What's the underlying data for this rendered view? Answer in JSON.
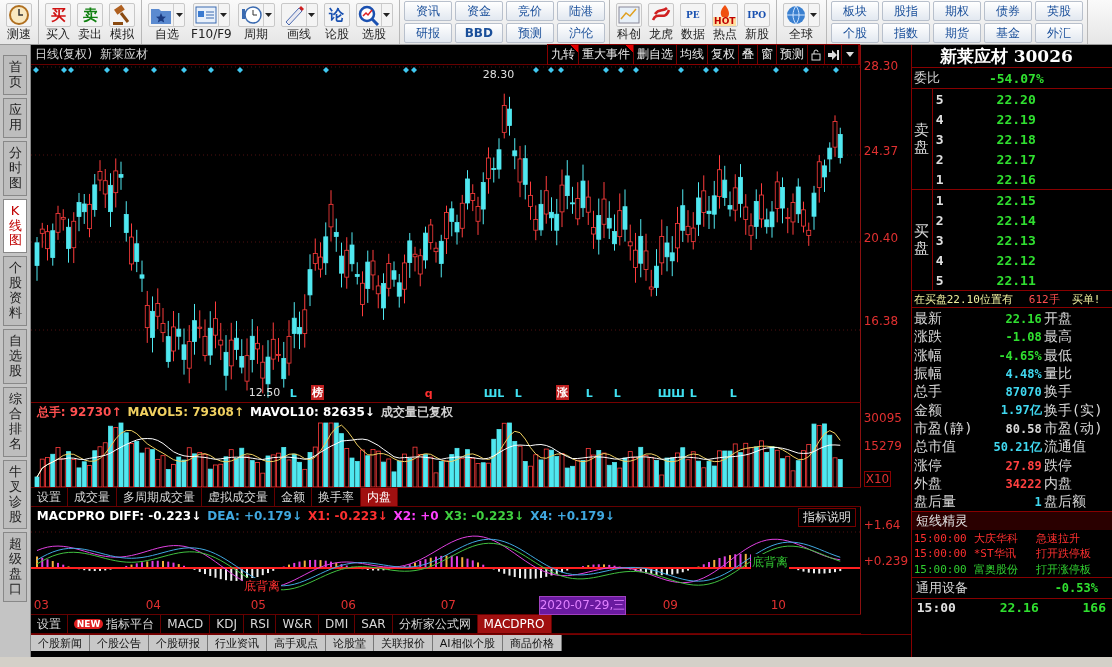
{
  "toolbar": {
    "groups": [
      {
        "kind": "tools",
        "items": [
          {
            "label": "测速",
            "dropdown": false
          }
        ]
      },
      {
        "kind": "tools",
        "items": [
          {
            "label": "买入",
            "glyph": "买",
            "dropdown": false
          },
          {
            "label": "卖出",
            "glyph": "卖",
            "dropdown": false
          },
          {
            "label": "模拟",
            "dropdown": false
          }
        ]
      },
      {
        "kind": "tools",
        "items": [
          {
            "label": "自选",
            "dropdown": true
          },
          {
            "label": "F10/F9",
            "dropdown": true
          },
          {
            "label": "周期",
            "dropdown": true
          },
          {
            "label": "画线",
            "dropdown": true
          },
          {
            "label": "论股",
            "glyph": "论",
            "dropdown": false
          },
          {
            "label": "选股",
            "dropdown": true
          }
        ]
      },
      {
        "kind": "grid",
        "rows": [
          [
            "资讯",
            "资金",
            "竞价",
            "陆港"
          ],
          [
            "研报",
            "BBD",
            "预测",
            "沪伦"
          ]
        ]
      },
      {
        "kind": "tools",
        "items": [
          {
            "label": "科创",
            "dropdown": false
          },
          {
            "label": "龙虎",
            "dropdown": false
          },
          {
            "label": "数据",
            "glyph": "PE",
            "dropdown": false
          },
          {
            "label": "热点",
            "glyph": "HOT",
            "dropdown": false
          },
          {
            "label": "新股",
            "glyph": "IPO",
            "dropdown": false
          }
        ]
      },
      {
        "kind": "tools",
        "items": [
          {
            "label": "全球",
            "dropdown": true
          }
        ]
      },
      {
        "kind": "grid",
        "rows": [
          [
            "板块",
            "股指",
            "期权",
            "债券",
            "英股"
          ],
          [
            "个股",
            "指数",
            "期货",
            "基金",
            "外汇"
          ]
        ]
      }
    ]
  },
  "side_tabs": [
    {
      "label": "首页",
      "selected": false
    },
    {
      "label": "应用",
      "selected": false
    },
    {
      "label": "分时图",
      "selected": false
    },
    {
      "label": "K线图",
      "selected": true
    },
    {
      "label": "个股资料",
      "selected": false
    },
    {
      "label": "自选股",
      "selected": false
    },
    {
      "label": "综合排名",
      "selected": false
    },
    {
      "label": "牛叉诊股",
      "selected": false
    },
    {
      "label": "超级盘口",
      "selected": false
    }
  ],
  "chart_header": {
    "period": "日线(复权)",
    "stock": "新莱应材",
    "buttons": [
      {
        "label": "九转",
        "flagged": true
      },
      {
        "label": "重大事件",
        "flagged": true
      },
      {
        "label": "删自选",
        "flagged": false
      },
      {
        "label": "均线",
        "flagged": false
      },
      {
        "label": "复权",
        "flagged": false
      },
      {
        "label": "叠",
        "flagged": false
      },
      {
        "label": "窗",
        "flagged": false
      },
      {
        "label": "预测",
        "flagged": false
      }
    ]
  },
  "kline": {
    "high_label": "28.30",
    "low_label": "12.50",
    "price_ticks": [
      "28.30",
      "24.37",
      "20.40",
      "16.38"
    ],
    "signals": [
      {
        "text": "L",
        "kind": "plain",
        "color": "#40e0f0"
      },
      {
        "text": "榜",
        "kind": "tag",
        "color": "#c02020"
      },
      {
        "text": "q",
        "kind": "plain",
        "color": "#ff3030"
      },
      {
        "text": "ШL",
        "kind": "plain",
        "color": "#40e0f0"
      },
      {
        "text": "L",
        "kind": "plain",
        "color": "#40e0f0"
      },
      {
        "text": "涨",
        "kind": "tag",
        "color": "#c02020"
      },
      {
        "text": "L",
        "kind": "plain",
        "color": "#40e0f0"
      },
      {
        "text": "L",
        "kind": "plain",
        "color": "#40e0f0"
      },
      {
        "text": "ШШ",
        "kind": "plain",
        "color": "#40e0f0"
      },
      {
        "text": "L",
        "kind": "plain",
        "color": "#40e0f0"
      },
      {
        "text": "L",
        "kind": "plain",
        "color": "#40e0f0"
      }
    ]
  },
  "volume": {
    "legend": [
      {
        "text": "总手: 92730↑",
        "color": "#ff5050"
      },
      {
        "text": "MAVOL5: 79308↑",
        "color": "#f0d060"
      },
      {
        "text": "MAVOL10: 82635↓",
        "color": "#ffffff"
      },
      {
        "text": "成交量已复权",
        "color": "#d0d0d0"
      }
    ],
    "ticks": [
      "30095",
      "15279"
    ],
    "scale": "X10",
    "tabs": [
      {
        "label": "设置",
        "selected": false
      },
      {
        "label": "成交量",
        "selected": false
      },
      {
        "label": "多周期成交量",
        "selected": false
      },
      {
        "label": "虚拟成交量",
        "selected": false
      },
      {
        "label": "金额",
        "selected": false
      },
      {
        "label": "换手率",
        "selected": false
      },
      {
        "label": "内盘",
        "selected": true
      }
    ]
  },
  "macd": {
    "legend": [
      {
        "text": "MACDPRO DIFF: -0.223↓",
        "color": "#ffffff"
      },
      {
        "text": "DEA: +0.179↓",
        "color": "#40a8e0"
      },
      {
        "text": "X1: -0.223↓",
        "color": "#ff3030"
      },
      {
        "text": "X2: +0",
        "color": "#ff40ff"
      },
      {
        "text": "X3: -0.223↓",
        "color": "#40d040"
      },
      {
        "text": "X4: +0.179↓",
        "color": "#40a8e0"
      }
    ],
    "help_button": "指标说明",
    "ticks": [
      "+1.64",
      "+0.239"
    ],
    "notes": [
      {
        "text": "底背离",
        "color": "#ff3030"
      },
      {
        "text": "底背离",
        "color": "#30c030"
      }
    ]
  },
  "date_axis": [
    {
      "text": "03",
      "selected": false
    },
    {
      "text": "04",
      "selected": false
    },
    {
      "text": "05",
      "selected": false
    },
    {
      "text": "06",
      "selected": false
    },
    {
      "text": "07",
      "selected": false
    },
    {
      "text": "2020-07-29,三",
      "selected": true
    },
    {
      "text": "09",
      "selected": false
    },
    {
      "text": "10",
      "selected": false
    }
  ],
  "indicator_tabs": [
    {
      "label": "设置",
      "selected": false
    },
    {
      "label": "指标平台",
      "badge": "NEW",
      "selected": false
    },
    {
      "label": "MACD",
      "selected": false
    },
    {
      "label": "KDJ",
      "selected": false
    },
    {
      "label": "RSI",
      "selected": false
    },
    {
      "label": "W&R",
      "selected": false
    },
    {
      "label": "DMI",
      "selected": false
    },
    {
      "label": "SAR",
      "selected": false
    },
    {
      "label": "分析家公式网",
      "selected": false
    },
    {
      "label": "MACDPRO",
      "selected": true
    }
  ],
  "news_tabs": [
    "个股新闻",
    "个股公告",
    "个股研报",
    "行业资讯",
    "高手观点",
    "论股堂",
    "关联报价",
    "AI相似个股",
    "商品价格"
  ],
  "quote": {
    "title": "新莱应材 30026",
    "ratio": {
      "label": "委比",
      "value": "-54.07%"
    },
    "sell": {
      "label": "卖盘",
      "levels": [
        {
          "level": "5",
          "price": "22.20"
        },
        {
          "level": "4",
          "price": "22.19"
        },
        {
          "level": "3",
          "price": "22.18"
        },
        {
          "level": "2",
          "price": "22.17"
        },
        {
          "level": "1",
          "price": "22.16"
        }
      ]
    },
    "buy": {
      "label": "买盘",
      "levels": [
        {
          "level": "1",
          "price": "22.15"
        },
        {
          "level": "2",
          "price": "22.14"
        },
        {
          "level": "3",
          "price": "22.13"
        },
        {
          "level": "4",
          "price": "22.12"
        },
        {
          "level": "5",
          "price": "22.11"
        }
      ]
    },
    "order_note": {
      "prefix": "在买盘22.10位置有",
      "amount": "612手",
      "suffix": "买单!"
    },
    "stats": [
      {
        "label": "最新",
        "value": "22.16",
        "color": "#30e030",
        "label2": "开盘"
      },
      {
        "label": "涨跌",
        "value": "-1.08",
        "color": "#30e030",
        "label2": "最高"
      },
      {
        "label": "涨幅",
        "value": "-4.65%",
        "color": "#30e030",
        "label2": "最低"
      },
      {
        "label": "振幅",
        "value": "4.48%",
        "color": "#40d8f0",
        "label2": "量比"
      },
      {
        "label": "总手",
        "value": "87070",
        "color": "#40d8f0",
        "label2": "换手"
      },
      {
        "label": "金额",
        "value": "1.97亿",
        "color": "#40d8f0",
        "label2": "换手(实)"
      },
      {
        "label": "市盈(静)",
        "value": "80.58",
        "color": "#d8d8d8",
        "label2": "市盈(动)"
      },
      {
        "label": "总市值",
        "value": "50.21亿",
        "color": "#40d8f0",
        "label2": "流通值"
      },
      {
        "label": "涨停",
        "value": "27.89",
        "color": "#ff4040",
        "label2": "跌停"
      },
      {
        "label": "外盘",
        "value": "34222",
        "color": "#ff4040",
        "label2": "内盘"
      },
      {
        "label": "盘后量",
        "value": "1",
        "color": "#40d8f0",
        "label2": "盘后额"
      }
    ],
    "alerts_title": "短线精灵",
    "alerts": [
      {
        "time": "15:00:00",
        "name": "大庆华科",
        "event": "急速拉升",
        "color": "#ff3030"
      },
      {
        "time": "15:00:00",
        "name": "*ST华讯",
        "event": "打开跌停板",
        "color": "#ff3030"
      },
      {
        "time": "15:00:00",
        "name": "富奥股份",
        "event": "打开涨停板",
        "color": "#30d030"
      }
    ],
    "sector": {
      "name": "通用设备",
      "change": "-0.53%"
    },
    "tick": {
      "time": "15:00",
      "price": "22.16",
      "volume": "166"
    }
  }
}
